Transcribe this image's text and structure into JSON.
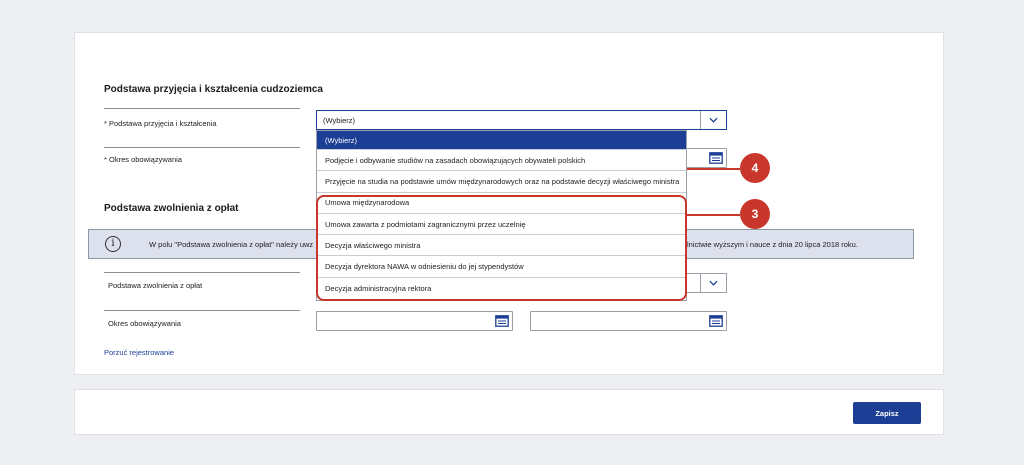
{
  "section1": {
    "title": "Podstawa przyjęcia i kształcenia cudzoziemca",
    "basis_label": "* Podstawa przyjęcia i kształcenia",
    "basis_value": "(Wybierz)",
    "period_label": "* Okres obowiązywania"
  },
  "dropdown": {
    "options": [
      "(Wybierz)",
      "Podjęcie i odbywanie studiów na zasadach obowiązujących obywateli polskich",
      "Przyjęcie na studia na podstawie umów międzynarodowych oraz na podstawie decyzji właściwego ministra",
      "Umowa międzynarodowa",
      "Umowa zawarta z podmiotami zagranicznymi przez uczelnię",
      "Decyzja właściwego ministra",
      "Decyzja dyrektora NAWA w odniesieniu do jej stypendystów",
      "Decyzja administracyjna rektora"
    ],
    "selected_index": 0
  },
  "section2": {
    "title": "Podstawa zwolnienia z opłat",
    "info_left": "W polu \"Podstawa zwolnienia z opłat\" należy uwz",
    "info_right": "lnictwie wyższym i nauce z dnia 20 lipca 2018 roku.",
    "exemption_label": "Podstawa zwolnienia z opłat",
    "period_label": "Okres obowiązywania"
  },
  "links": {
    "abandon": "Porzuć rejestrowanie"
  },
  "buttons": {
    "save": "Zapisz"
  },
  "annotations": {
    "badge_3": "3",
    "badge_4": "4"
  },
  "colors": {
    "accent": "#1c3f95",
    "annotation": "#c9372c",
    "info_bg": "#dde1ed"
  }
}
